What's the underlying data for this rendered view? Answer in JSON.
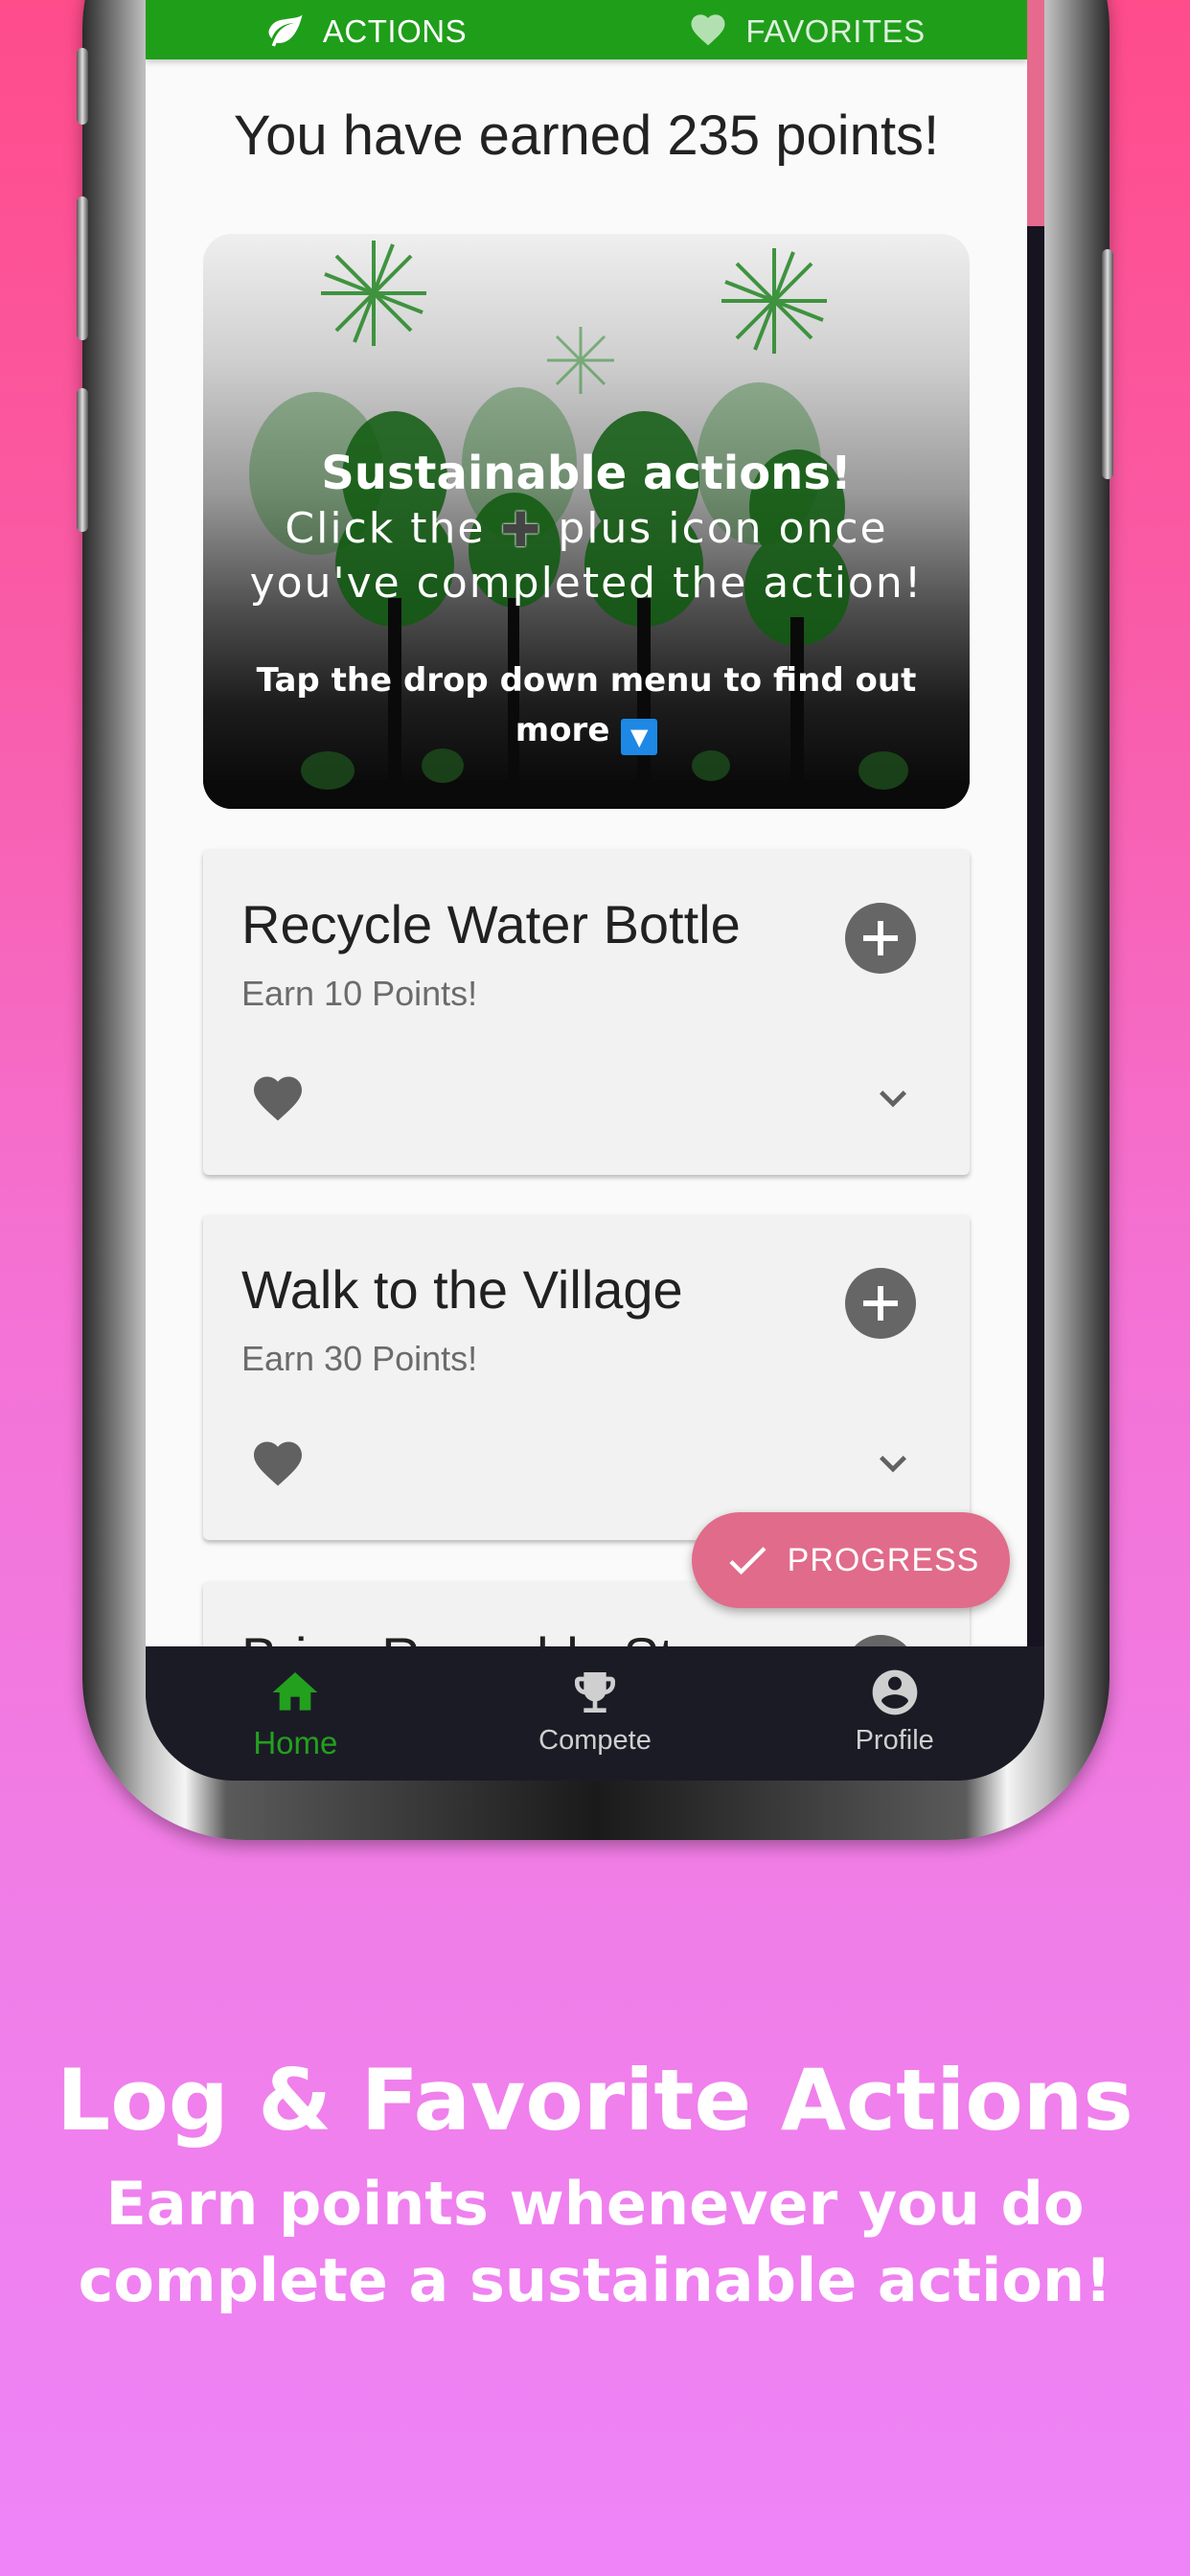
{
  "tabs": [
    {
      "label": "ACTIONS",
      "icon": "leaf-icon",
      "active": true
    },
    {
      "label": "FAVORITES",
      "icon": "heart-icon",
      "active": false
    }
  ],
  "points_message": "You have earned 235 points!",
  "hero": {
    "title": "Sustainable actions!",
    "body_before_icon": "Click the",
    "body_after_icon": "plus icon once",
    "body_line2": "you've completed the action!",
    "note": "Tap the drop down menu to find out more"
  },
  "actions": [
    {
      "title": "Recycle Water Bottle",
      "subtitle": "Earn 10 Points!"
    },
    {
      "title": "Walk to the Village",
      "subtitle": "Earn 30 Points!"
    },
    {
      "title": "Bring Reusable Straw",
      "subtitle": ""
    }
  ],
  "fab_label": "PROGRESS",
  "bottom_nav": [
    {
      "label": "Home",
      "icon": "home-icon",
      "active": true
    },
    {
      "label": "Compete",
      "icon": "trophy-icon",
      "active": false
    },
    {
      "label": "Profile",
      "icon": "account-circle-icon",
      "active": false
    }
  ],
  "promo": {
    "title": "Log & Favorite Actions",
    "subtitle_line1": "Earn points whenever you do",
    "subtitle_line2": "complete a sustainable action!"
  },
  "colors": {
    "tab_green": "#1f9e1a",
    "fab_pink": "#e16b8a",
    "nav_active": "#23a01d",
    "nav_background": "#1b1b26"
  }
}
